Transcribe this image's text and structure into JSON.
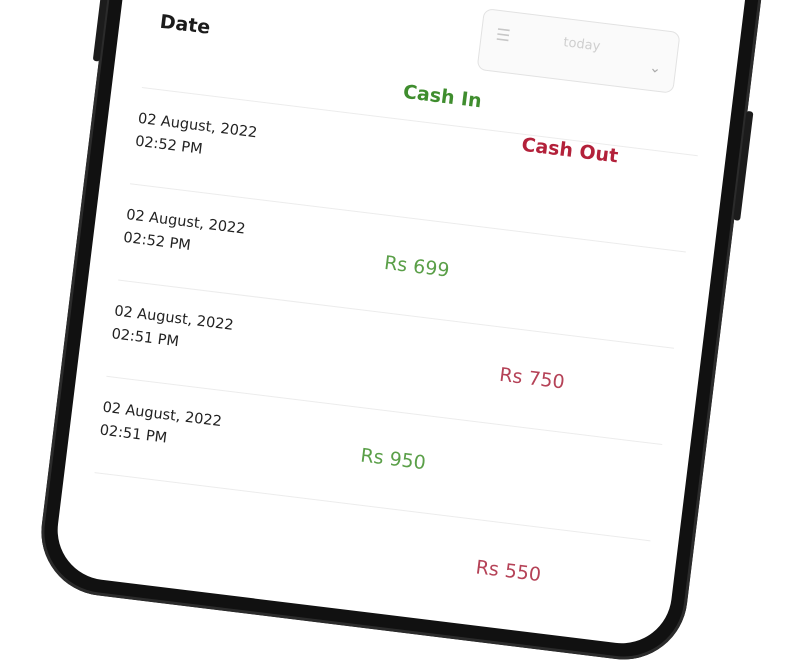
{
  "header": {
    "date_label": "Date",
    "filter_value": "today",
    "cash_in_label": "Cash In",
    "cash_out_label": "Cash Out"
  },
  "transactions": [
    {
      "date": "02 August, 2022",
      "time": "02:52 PM",
      "cash_in": "",
      "cash_out": ""
    },
    {
      "date": "02 August, 2022",
      "time": "02:52 PM",
      "cash_in": "Rs 699",
      "cash_out": ""
    },
    {
      "date": "02 August, 2022",
      "time": "02:51 PM",
      "cash_in": "",
      "cash_out": "Rs 750"
    },
    {
      "date": "02 August, 2022",
      "time": "02:51 PM",
      "cash_in": "Rs 950",
      "cash_out": ""
    },
    {
      "date": "",
      "time": "",
      "cash_in": "",
      "cash_out": "Rs 550"
    }
  ],
  "colors": {
    "cash_in": "#3f8d2e",
    "cash_out": "#b3213a",
    "phone_frame": "#111111"
  },
  "icons": {
    "filter_menu": "filter-lines-icon",
    "filter_chevron": "chevron-down-icon"
  }
}
